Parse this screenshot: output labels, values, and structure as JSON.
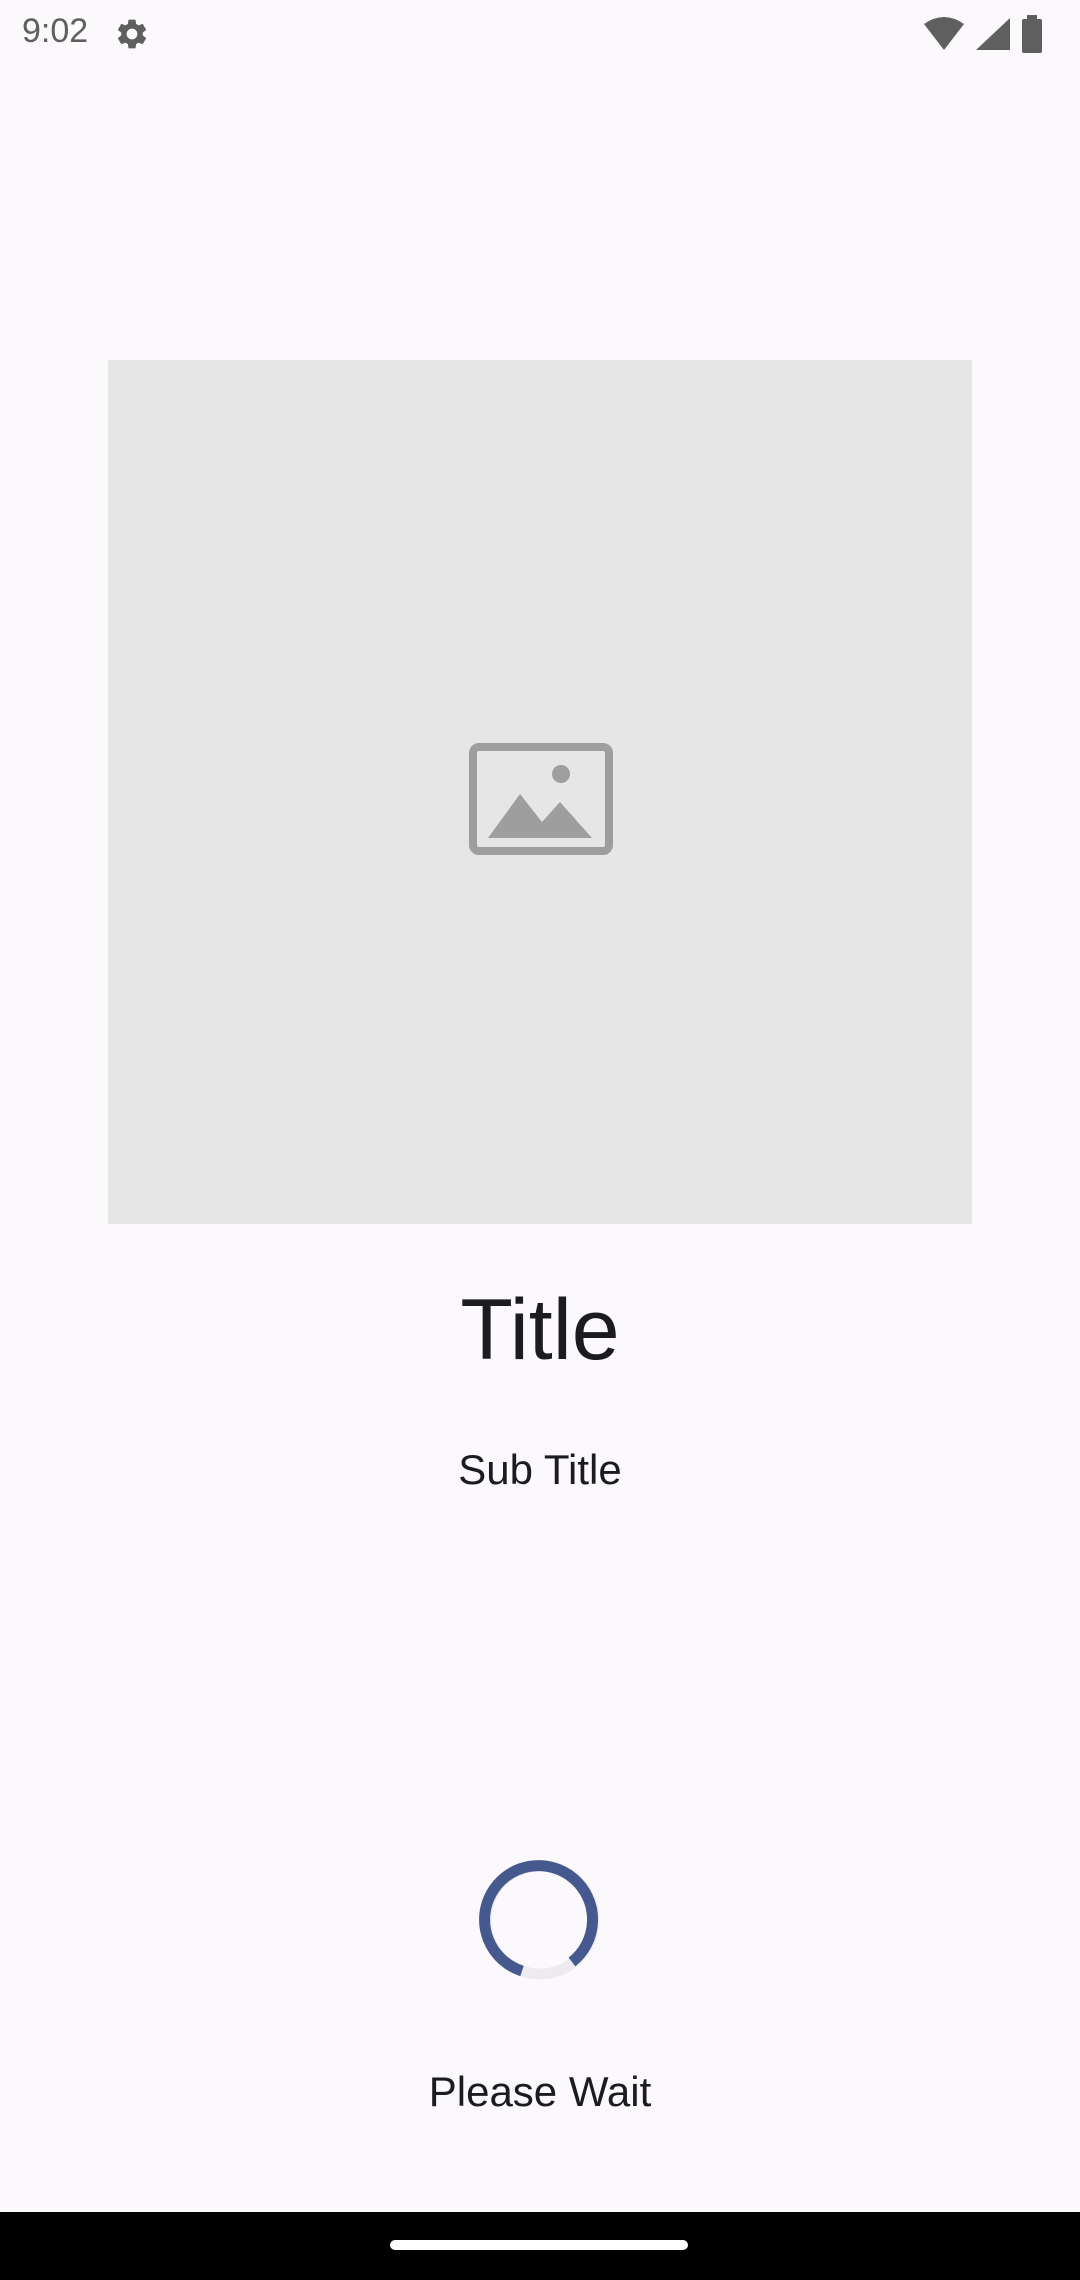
{
  "status_bar": {
    "time": "9:02",
    "icons": [
      "gear-icon",
      "wifi-icon",
      "signal-icon",
      "battery-icon"
    ]
  },
  "content": {
    "image_placeholder_icon": "image-placeholder-icon",
    "title": "Title",
    "subtitle": "Sub Title"
  },
  "loading": {
    "text": "Please Wait",
    "spinner_color": "#46598F"
  },
  "colors": {
    "background": "#FCF9FC",
    "image_card": "#E6E6E6",
    "icon_gray": "#9E9E9E",
    "text": "#1C1B1F"
  }
}
